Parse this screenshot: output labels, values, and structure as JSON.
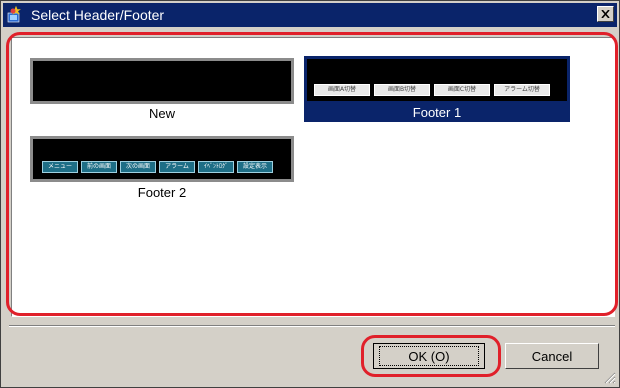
{
  "window": {
    "title": "Select Header/Footer",
    "icon": "app-icon",
    "close_icon": "close-icon",
    "colors": {
      "titlebar": "#0a246a",
      "face": "#d4d0c8",
      "selection": "#0a246a",
      "annotation": "#e0202a"
    }
  },
  "items": [
    {
      "label": "New",
      "selected": false,
      "buttons": []
    },
    {
      "label": "Footer 1",
      "selected": true,
      "buttons": [
        "画面A切替",
        "画面B切替",
        "画面C切替",
        "アラーム切替"
      ]
    },
    {
      "label": "Footer 2",
      "selected": false,
      "buttons": [
        "メニュー",
        "前の画面",
        "次の画面",
        "アラーム",
        "ｲﾍﾞﾝﾄﾛｸﾞ",
        "設定表示"
      ]
    }
  ],
  "buttons": {
    "ok": "OK (O)",
    "cancel": "Cancel"
  }
}
